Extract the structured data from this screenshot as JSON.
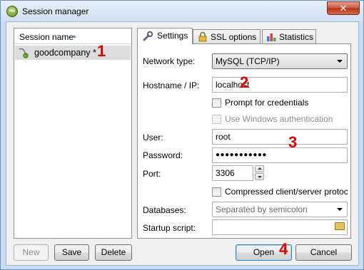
{
  "window": {
    "title": "Session manager",
    "app_badge": "HS",
    "close_glyph": "✕"
  },
  "sessions": {
    "column_header": "Session name",
    "items": [
      {
        "label": "goodcompany *"
      }
    ]
  },
  "tabs": [
    {
      "label": "Settings",
      "icon": "wrench-icon",
      "active": true
    },
    {
      "label": "SSL options",
      "icon": "lock-icon",
      "active": false
    },
    {
      "label": "Statistics",
      "icon": "bar-chart-icon",
      "active": false
    }
  ],
  "settings": {
    "network_type_label": "Network type:",
    "network_type_value": "MySQL (TCP/IP)",
    "hostname_label": "Hostname / IP:",
    "hostname_value": "localhost",
    "prompt_credentials_label": "Prompt for credentials",
    "prompt_credentials_checked": false,
    "windows_auth_label": "Use Windows authentication",
    "windows_auth_checked": false,
    "user_label": "User:",
    "user_value": "root",
    "password_label": "Password:",
    "password_value": "●●●●●●●●●●●",
    "port_label": "Port:",
    "port_value": "3306",
    "compressed_label": "Compressed client/server protoco",
    "compressed_checked": false,
    "databases_label": "Databases:",
    "databases_placeholder": "Separated by semicolon",
    "startup_script_label": "Startup script:",
    "startup_script_value": ""
  },
  "buttons": {
    "new": "New",
    "save": "Save",
    "delete": "Delete",
    "open": "Open",
    "cancel": "Cancel"
  },
  "annotations": [
    "1",
    "2",
    "3",
    "4"
  ],
  "colors": {
    "annotation": "#e00000",
    "selected_row": "#dcdcdc"
  }
}
